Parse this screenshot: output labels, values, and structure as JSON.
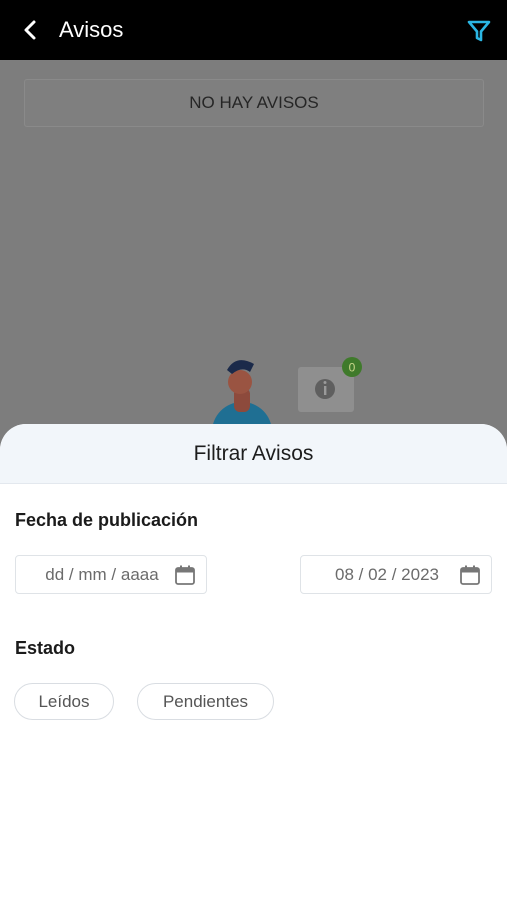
{
  "header": {
    "title": "Avisos",
    "back_icon": "chevron-left-icon",
    "filter_icon": "filter-icon",
    "filter_color": "#2bb6e3"
  },
  "main": {
    "empty_message": "NO HAY AVISOS",
    "notification_count": "0"
  },
  "filter_sheet": {
    "title": "Filtrar Avisos",
    "date_label": "Fecha de publicación",
    "date_from_value": "dd / mm / aaaa",
    "date_to_value": "08 / 02 / 2023",
    "calendar_icon": "calendar-icon",
    "status_label": "Estado",
    "status_options": [
      "Leídos",
      "Pendientes"
    ]
  }
}
